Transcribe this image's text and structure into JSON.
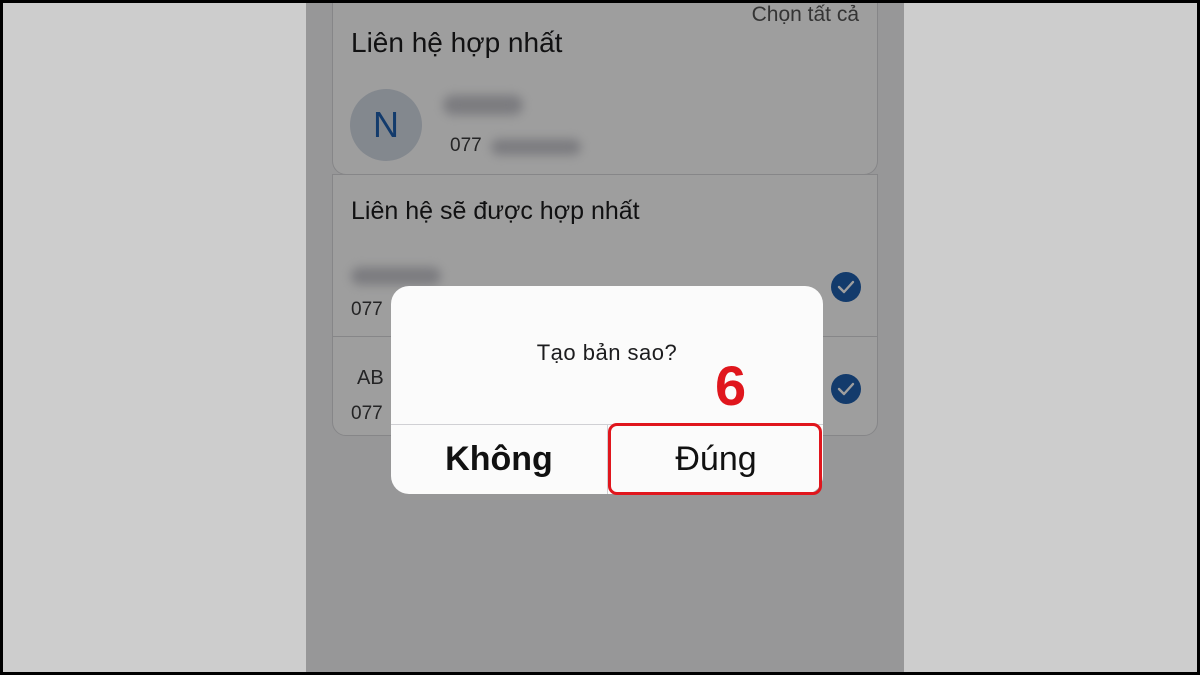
{
  "merge_card": {
    "select_all": "Chọn tất cả",
    "title": "Liên hệ hợp nhất",
    "avatar_letter": "N",
    "phone_prefix": "077"
  },
  "to_merge_card": {
    "title": "Liên hệ sẽ được hợp nhất",
    "rows": [
      {
        "phone_prefix": "077",
        "name_prefix": ""
      },
      {
        "phone_prefix": "077",
        "name_prefix": "AB"
      }
    ]
  },
  "dialog": {
    "message": "Tạo bản sao?",
    "no_label": "Không",
    "yes_label": "Đúng"
  },
  "annotation": {
    "step": "6"
  },
  "colors": {
    "accent": "#1f5fae",
    "highlight": "#e0161d"
  }
}
